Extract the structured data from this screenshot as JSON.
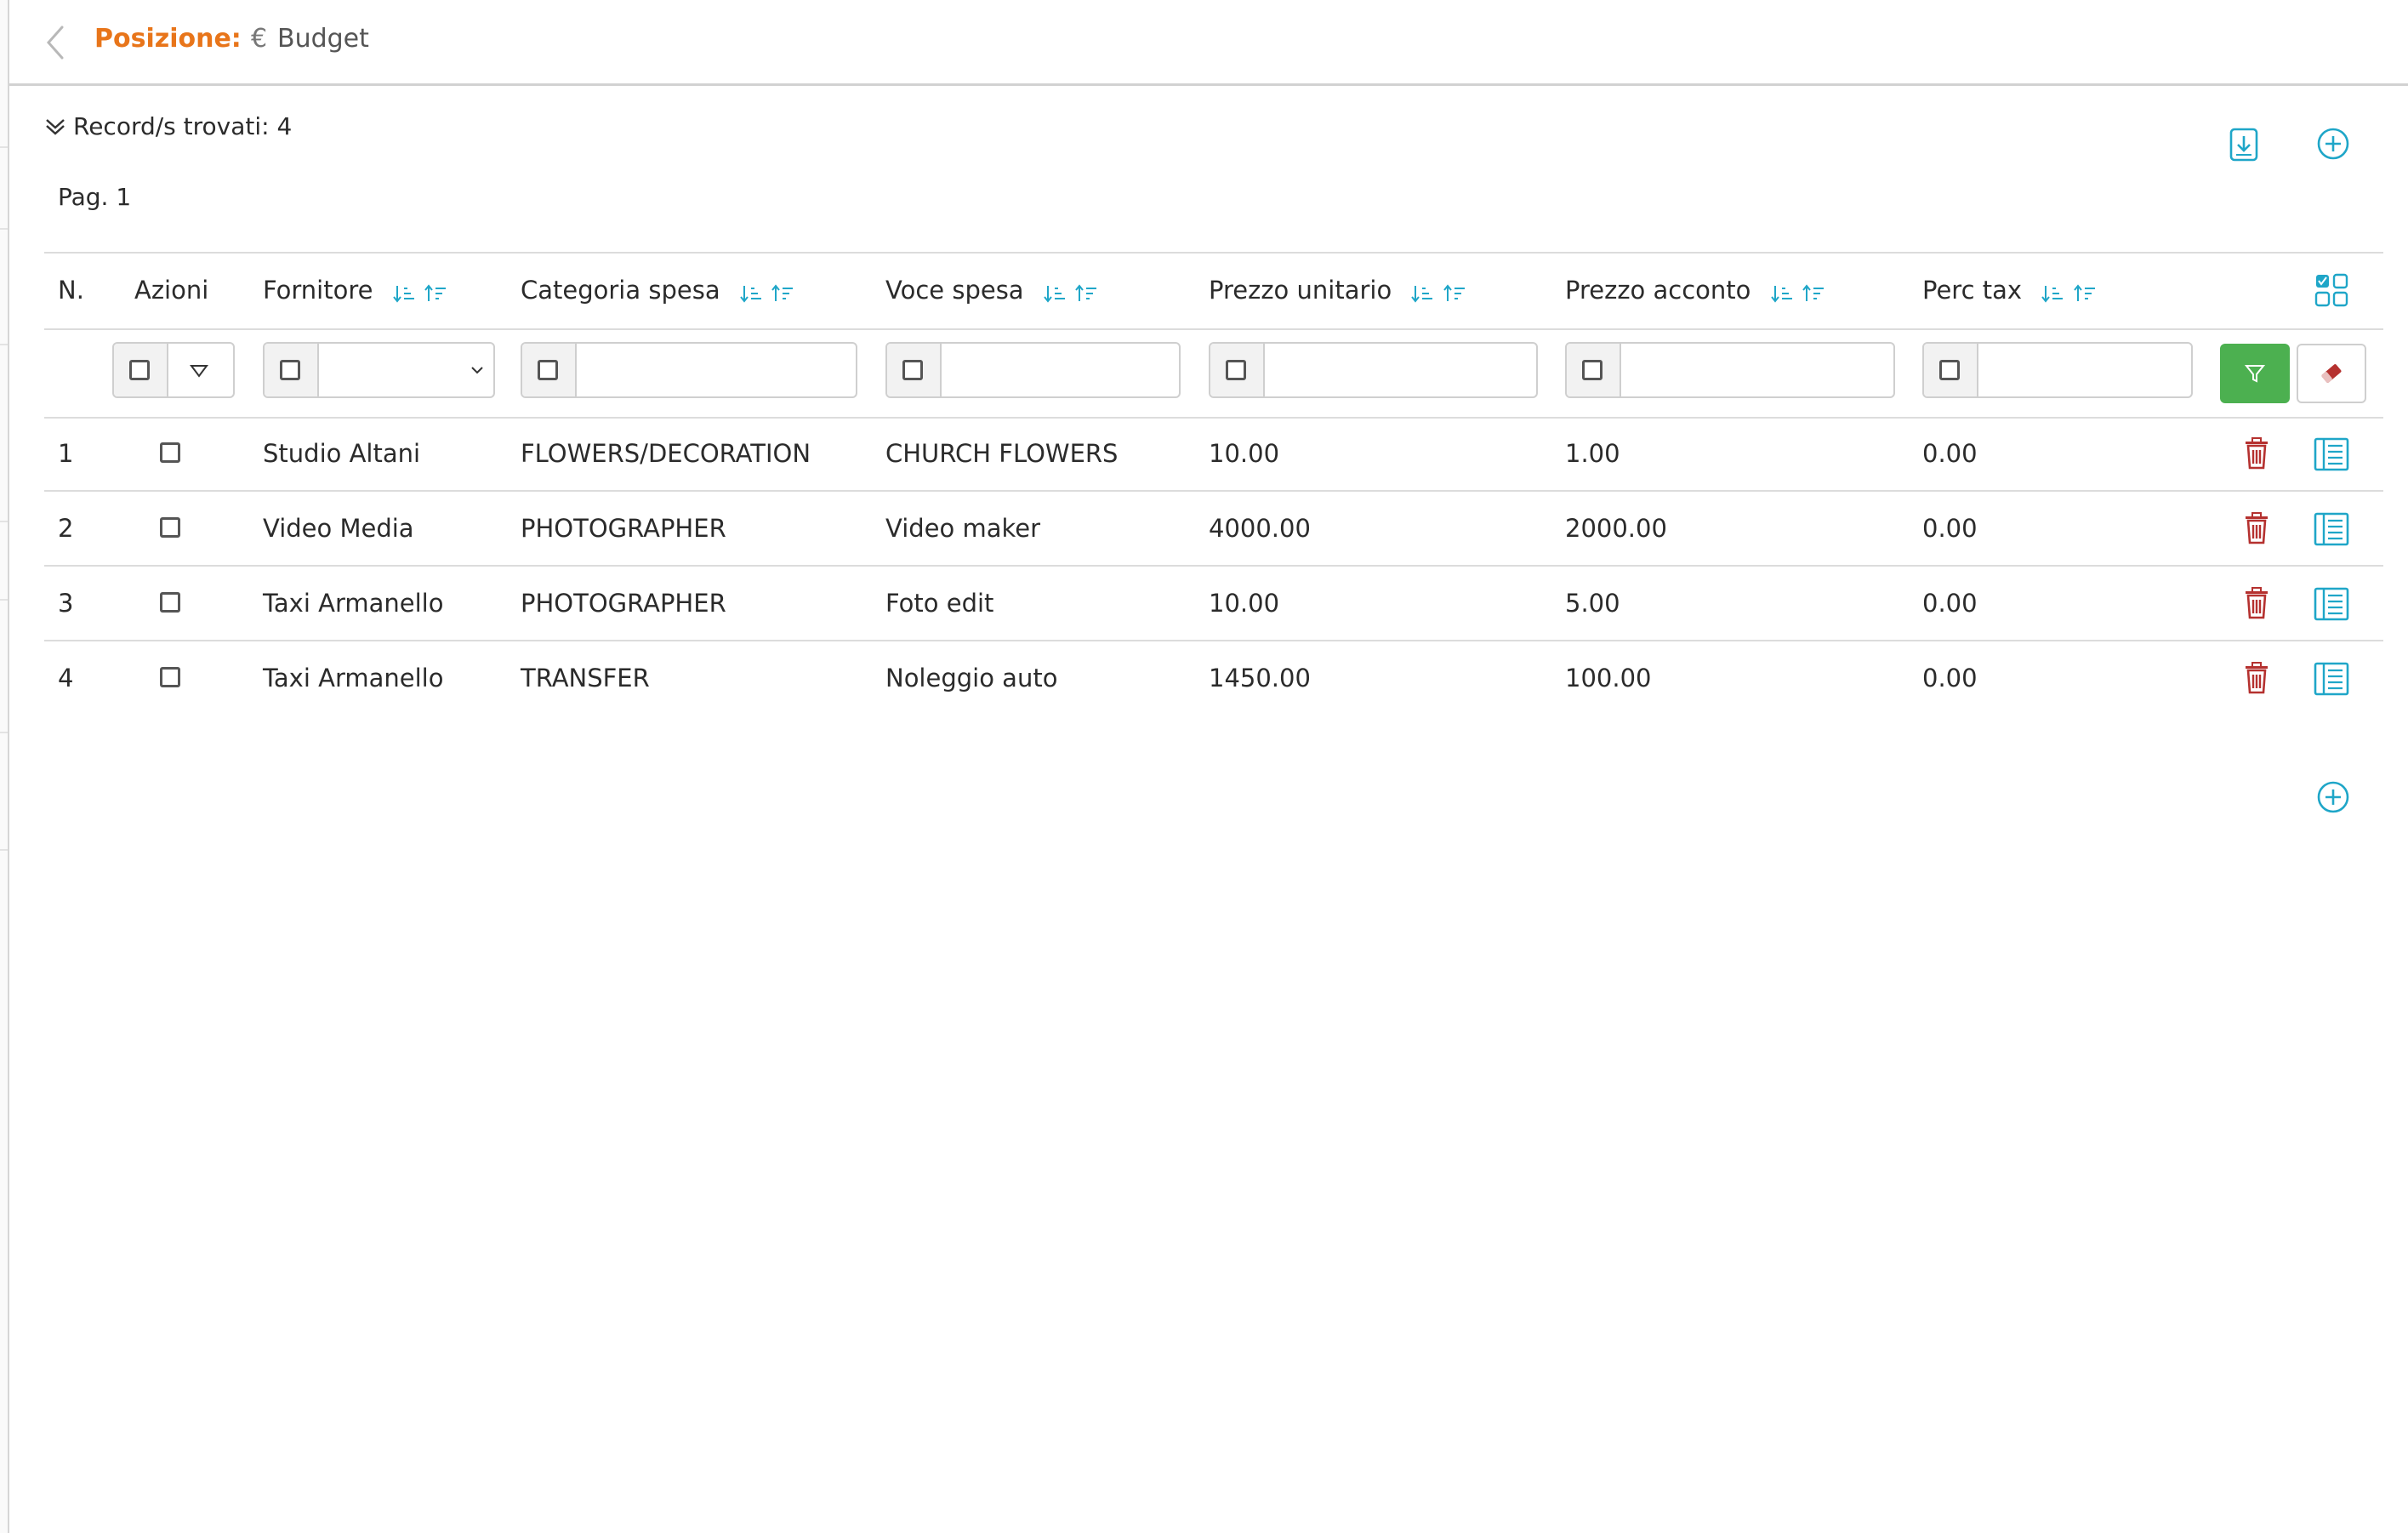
{
  "header": {
    "position_label": "Posizione:",
    "currency_symbol": "€",
    "position_value": "Budget"
  },
  "toolbar": {
    "records_found": "Record/s trovati: 4",
    "page": "Pag. 1"
  },
  "table": {
    "columns": [
      {
        "label": "N.",
        "sortable": false
      },
      {
        "label": "Azioni",
        "sortable": false
      },
      {
        "label": "Fornitore",
        "sortable": true
      },
      {
        "label": "Categoria spesa",
        "sortable": true
      },
      {
        "label": "Voce spesa",
        "sortable": true
      },
      {
        "label": "Prezzo unitario",
        "sortable": true
      },
      {
        "label": "Prezzo acconto",
        "sortable": true
      },
      {
        "label": "Perc tax",
        "sortable": true
      }
    ],
    "rows": [
      {
        "n": "1",
        "fornitore": "Studio Altani",
        "categoria": "FLOWERS/DECORATION",
        "voce": "CHURCH FLOWERS",
        "prezzo_unitario": "10.00",
        "prezzo_acconto": "1.00",
        "perc_tax": "0.00"
      },
      {
        "n": "2",
        "fornitore": "Video Media",
        "categoria": "PHOTOGRAPHER",
        "voce": "Video maker",
        "prezzo_unitario": "4000.00",
        "prezzo_acconto": "2000.00",
        "perc_tax": "0.00"
      },
      {
        "n": "3",
        "fornitore": "Taxi Armanello",
        "categoria": "PHOTOGRAPHER",
        "voce": "Foto edit",
        "prezzo_unitario": "10.00",
        "prezzo_acconto": "5.00",
        "perc_tax": "0.00"
      },
      {
        "n": "4",
        "fornitore": "Taxi Armanello",
        "categoria": "TRANSFER",
        "voce": "Noleggio auto",
        "prezzo_unitario": "1450.00",
        "prezzo_acconto": "100.00",
        "perc_tax": "0.00"
      }
    ]
  },
  "icons": {
    "back": "chevron-left-icon",
    "expand": "double-chevron-down-icon",
    "export": "download-document-icon",
    "add": "plus-circle-icon",
    "columns": "grid-icon",
    "filter": "funnel-icon",
    "clear": "eraser-icon",
    "delete": "trash-icon",
    "detail": "list-detail-icon",
    "sort_asc": "sort-ascending-icon",
    "sort_desc": "sort-descending-icon"
  },
  "colors": {
    "accent_orange": "#e8751a",
    "icon_blue": "#1fa6c8",
    "filter_green": "#4cb050",
    "delete_red": "#b5312f"
  }
}
